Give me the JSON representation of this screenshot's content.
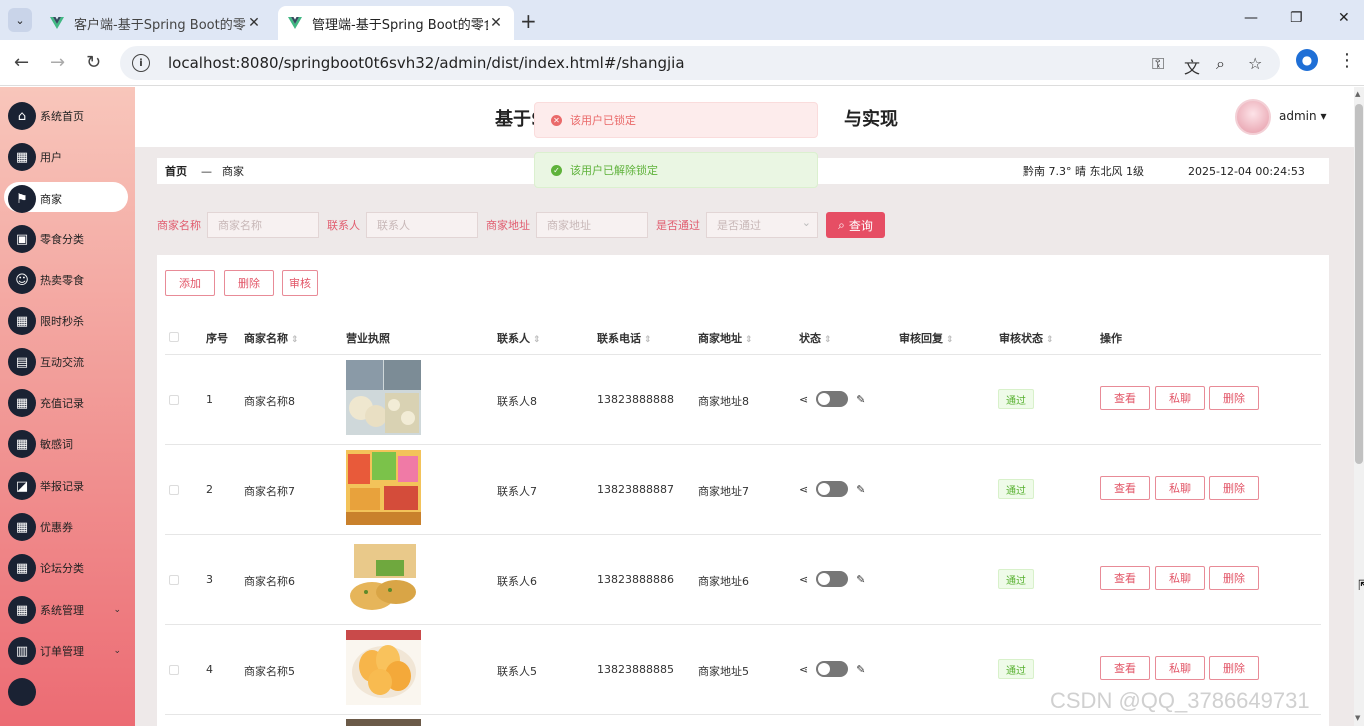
{
  "browser": {
    "tabs": [
      {
        "title": "客户端-基于Spring Boot的零食"
      },
      {
        "title": "管理端-基于Spring Boot的零食"
      }
    ],
    "url": "localhost:8080/springboot0t6svh32/admin/dist/index.html#/shangjia"
  },
  "sidebar": {
    "items": [
      {
        "label": "系统首页",
        "icon": "home-icon"
      },
      {
        "label": "用户",
        "icon": "grid-icon"
      },
      {
        "label": "商家",
        "icon": "flag-icon"
      },
      {
        "label": "零食分类",
        "icon": "briefcase-icon"
      },
      {
        "label": "热卖零食",
        "icon": "smile-icon"
      },
      {
        "label": "限时秒杀",
        "icon": "grid-icon"
      },
      {
        "label": "互动交流",
        "icon": "wallet-icon"
      },
      {
        "label": "充值记录",
        "icon": "grid-icon"
      },
      {
        "label": "敏感词",
        "icon": "grid-icon"
      },
      {
        "label": "举报记录",
        "icon": "ticket-icon"
      },
      {
        "label": "优惠券",
        "icon": "grid-icon"
      },
      {
        "label": "论坛分类",
        "icon": "grid-icon"
      },
      {
        "label": "系统管理",
        "icon": "grid-icon"
      },
      {
        "label": "订单管理",
        "icon": "clipboard-icon"
      }
    ]
  },
  "header": {
    "title_left": "基于S",
    "title_right": "与实现",
    "user": "admin"
  },
  "breadcrumb": {
    "home": "首页",
    "sep": "—",
    "current": "商家"
  },
  "weather": "黔南  7.3°  晴  东北风  1级",
  "datetime": "2025-12-04 00:24:53",
  "toasts": {
    "error": "该用户已锁定",
    "success": "该用户已解除锁定"
  },
  "search": {
    "name_label": "商家名称",
    "name_placeholder": "商家名称",
    "contact_label": "联系人",
    "contact_placeholder": "联系人",
    "address_label": "商家地址",
    "address_placeholder": "商家地址",
    "approved_label": "是否通过",
    "approved_placeholder": "是否通过",
    "button": "查询"
  },
  "actions": {
    "add": "添加",
    "delete": "删除",
    "review": "审核"
  },
  "table": {
    "headers": {
      "index": "序号",
      "name": "商家名称",
      "license": "营业执照",
      "contact": "联系人",
      "phone": "联系电话",
      "address": "商家地址",
      "status": "状态",
      "reply": "审核回复",
      "review_status": "审核状态",
      "ops": "操作"
    },
    "rows": [
      {
        "index": "1",
        "name": "商家名称8",
        "contact": "联系人8",
        "phone": "13823888888",
        "address": "商家地址8",
        "review_status": "通过"
      },
      {
        "index": "2",
        "name": "商家名称7",
        "contact": "联系人7",
        "phone": "13823888887",
        "address": "商家地址7",
        "review_status": "通过"
      },
      {
        "index": "3",
        "name": "商家名称6",
        "contact": "联系人6",
        "phone": "13823888886",
        "address": "商家地址6",
        "review_status": "通过"
      },
      {
        "index": "4",
        "name": "商家名称5",
        "contact": "联系人5",
        "phone": "13823888885",
        "address": "商家地址5",
        "review_status": "通过"
      }
    ],
    "row_buttons": {
      "view": "查看",
      "chat": "私聊",
      "delete": "删除"
    }
  },
  "watermark": "CSDN @QQ_3786649731"
}
